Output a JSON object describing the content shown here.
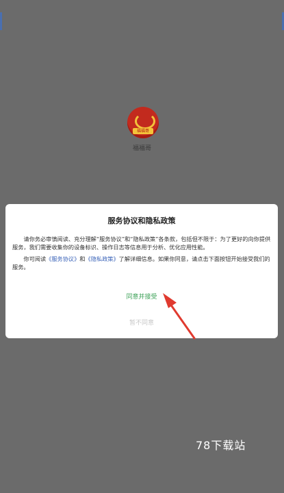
{
  "app": {
    "logo_text": "福福哥",
    "name": "福福哥"
  },
  "dialog": {
    "title": "服务协议和隐私政策",
    "para1": "请你务必审慎阅读、充分理解“服务协议”和“隐私政策”各条款，包括但不限于：为了更好的向你提供服务，我们需要收集你的设备标识、操作日志等信息用于分析、优化应用性能。",
    "para2_prefix": "你可阅读",
    "link_service": "《服务协议》",
    "para2_and": "和",
    "link_privacy": "《隐私政策》",
    "para2_suffix": "了解详细信息。如果你同意，请点击下面按钮开始接受我们的服务。",
    "accept_label": "同意并接受",
    "decline_label": "暂不同意"
  },
  "watermark": "78下载站",
  "colors": {
    "overlay": "#6b6b6b",
    "accept": "#3fa35a",
    "link": "#3a63b8",
    "arrow": "#e03a2f"
  }
}
